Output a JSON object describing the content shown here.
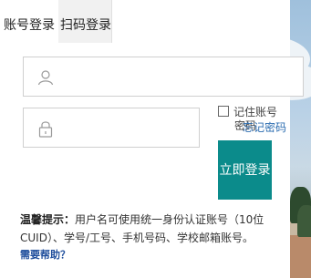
{
  "tabs": [
    {
      "label": "账号登录"
    },
    {
      "label": "扫码登录"
    }
  ],
  "username": {
    "value": "",
    "placeholder": "",
    "icon": "user-icon"
  },
  "password": {
    "value": "",
    "placeholder": "",
    "icon": "lock-icon"
  },
  "remember": {
    "label": "记住账号",
    "checked": false
  },
  "password_word": "密码",
  "forgot": "忘记密码",
  "login_button": "立即登录",
  "tips": {
    "title": "温馨提示：",
    "text": "用户名可使用统一身份认证账号（10位CUID）、学号/工号、手机号码、学校邮箱账号。"
  },
  "help": "需要帮助？",
  "colors": {
    "accent": "#0b8b8b",
    "link": "#2b6cb0"
  }
}
